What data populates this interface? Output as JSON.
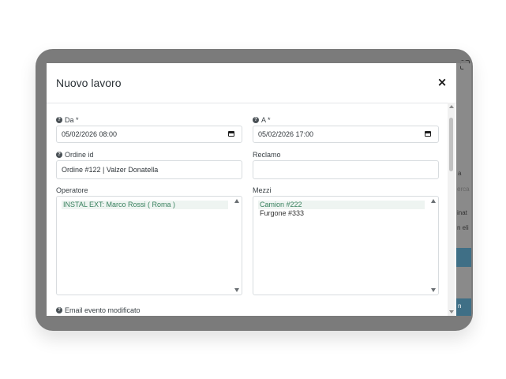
{
  "modal": {
    "title": "Nuovo lavoro",
    "close_glyph": "×"
  },
  "form": {
    "da": {
      "label": "Da *",
      "value": "05/02/2026 08:00",
      "icon": "calendar-icon"
    },
    "a": {
      "label": "A *",
      "value": "05/02/2026 17:00",
      "icon": "calendar-icon"
    },
    "ordine_id": {
      "label": "Ordine id",
      "value": "Ordine #122 | Valzer Donatella"
    },
    "reclamo": {
      "label": "Reclamo",
      "value": ""
    },
    "operatore": {
      "label": "Operatore",
      "options": [
        {
          "text": "INSTAL EXT: Marco Rossi ( Roma )",
          "selected": true
        }
      ]
    },
    "mezzi": {
      "label": "Mezzi",
      "options": [
        {
          "text": "Camion #222",
          "selected": true
        },
        {
          "text": "Furgone #333",
          "selected": false
        }
      ]
    },
    "email_evento": {
      "label": "Email evento modificato"
    },
    "help_glyph": "?"
  },
  "background": {
    "texts": [
      "a",
      "erca",
      "inat",
      "n eli",
      "n"
    ]
  },
  "colors": {
    "overlay": "#7b7b7b",
    "selected_option_bg": "#eef4f1",
    "selected_option_text": "#37805d",
    "accent_blue": "#3f6f86"
  }
}
